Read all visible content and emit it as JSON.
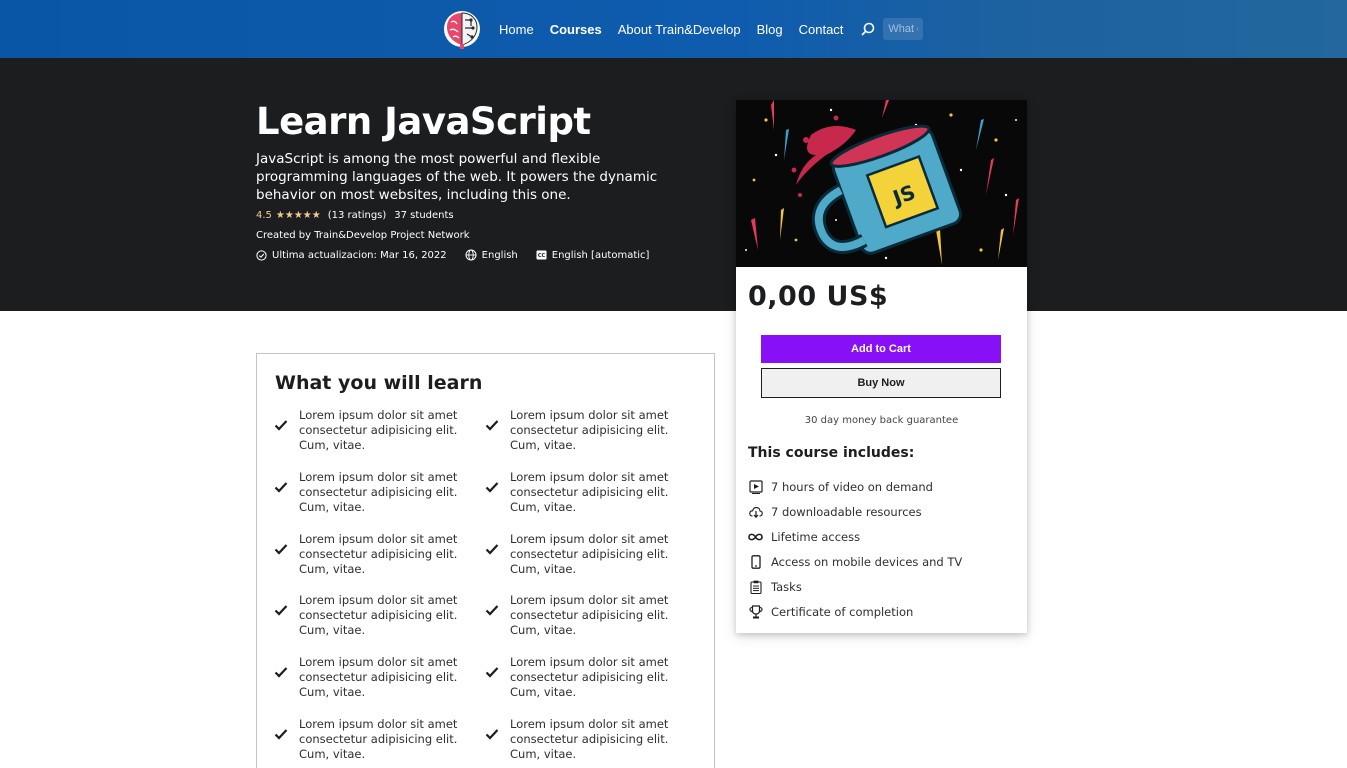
{
  "nav": {
    "links": [
      {
        "label": "Home",
        "active": false
      },
      {
        "label": "Courses",
        "active": true
      },
      {
        "label": "About Train&Develop",
        "active": false
      },
      {
        "label": "Blog",
        "active": false
      },
      {
        "label": "Contact",
        "active": false
      }
    ],
    "search_placeholder": "What do you want to learn?"
  },
  "hero": {
    "title": "Learn JavaScript",
    "description": "JavaScript is among the most powerful and flexible programming languages of the web. It powers the dynamic behavior on most websites, including this one.",
    "rating": "4.5",
    "stars": "★★★★★",
    "ratings_count": "(13 ratings)",
    "students": "37 students",
    "created_by": "Created by Train&Develop Project Network",
    "last_updated": "Ultima actualizacion: Mar 16, 2022",
    "language": "English",
    "captions": "English [automatic]"
  },
  "learn": {
    "title": "What you will learn",
    "items": [
      "Lorem ipsum dolor sit amet consectetur adipisicing elit. Cum, vitae.",
      "Lorem ipsum dolor sit amet consectetur adipisicing elit. Cum, vitae.",
      "Lorem ipsum dolor sit amet consectetur adipisicing elit. Cum, vitae.",
      "Lorem ipsum dolor sit amet consectetur adipisicing elit. Cum, vitae.",
      "Lorem ipsum dolor sit amet consectetur adipisicing elit. Cum, vitae.",
      "Lorem ipsum dolor sit amet consectetur adipisicing elit. Cum, vitae.",
      "Lorem ipsum dolor sit amet consectetur adipisicing elit. Cum, vitae.",
      "Lorem ipsum dolor sit amet consectetur adipisicing elit. Cum, vitae.",
      "Lorem ipsum dolor sit amet consectetur adipisicing elit. Cum, vitae.",
      "Lorem ipsum dolor sit amet consectetur adipisicing elit. Cum, vitae.",
      "Lorem ipsum dolor sit amet consectetur adipisicing elit. Cum, vitae.",
      "Lorem ipsum dolor sit amet consectetur adipisicing elit. Cum, vitae."
    ]
  },
  "card": {
    "preview_badge": "JS",
    "price": "0,00 US$",
    "add_to_cart": "Add to Cart",
    "buy_now": "Buy Now",
    "guarantee": "30 day money back guarantee",
    "includes_title": "This course includes:",
    "includes": [
      {
        "icon": "video-icon",
        "label": "7 hours of video on demand"
      },
      {
        "icon": "download-icon",
        "label": "7 downloadable resources"
      },
      {
        "icon": "infinity-icon",
        "label": "Lifetime access"
      },
      {
        "icon": "mobile-icon",
        "label": "Access on mobile devices and TV"
      },
      {
        "icon": "clipboard-icon",
        "label": "Tasks"
      },
      {
        "icon": "trophy-icon",
        "label": "Certificate of completion"
      }
    ]
  },
  "colors": {
    "nav_bg": "#0a56a6",
    "hero_bg": "#1c1d1f",
    "star": "#f3ca8c",
    "cart_button": "#8710f7"
  }
}
